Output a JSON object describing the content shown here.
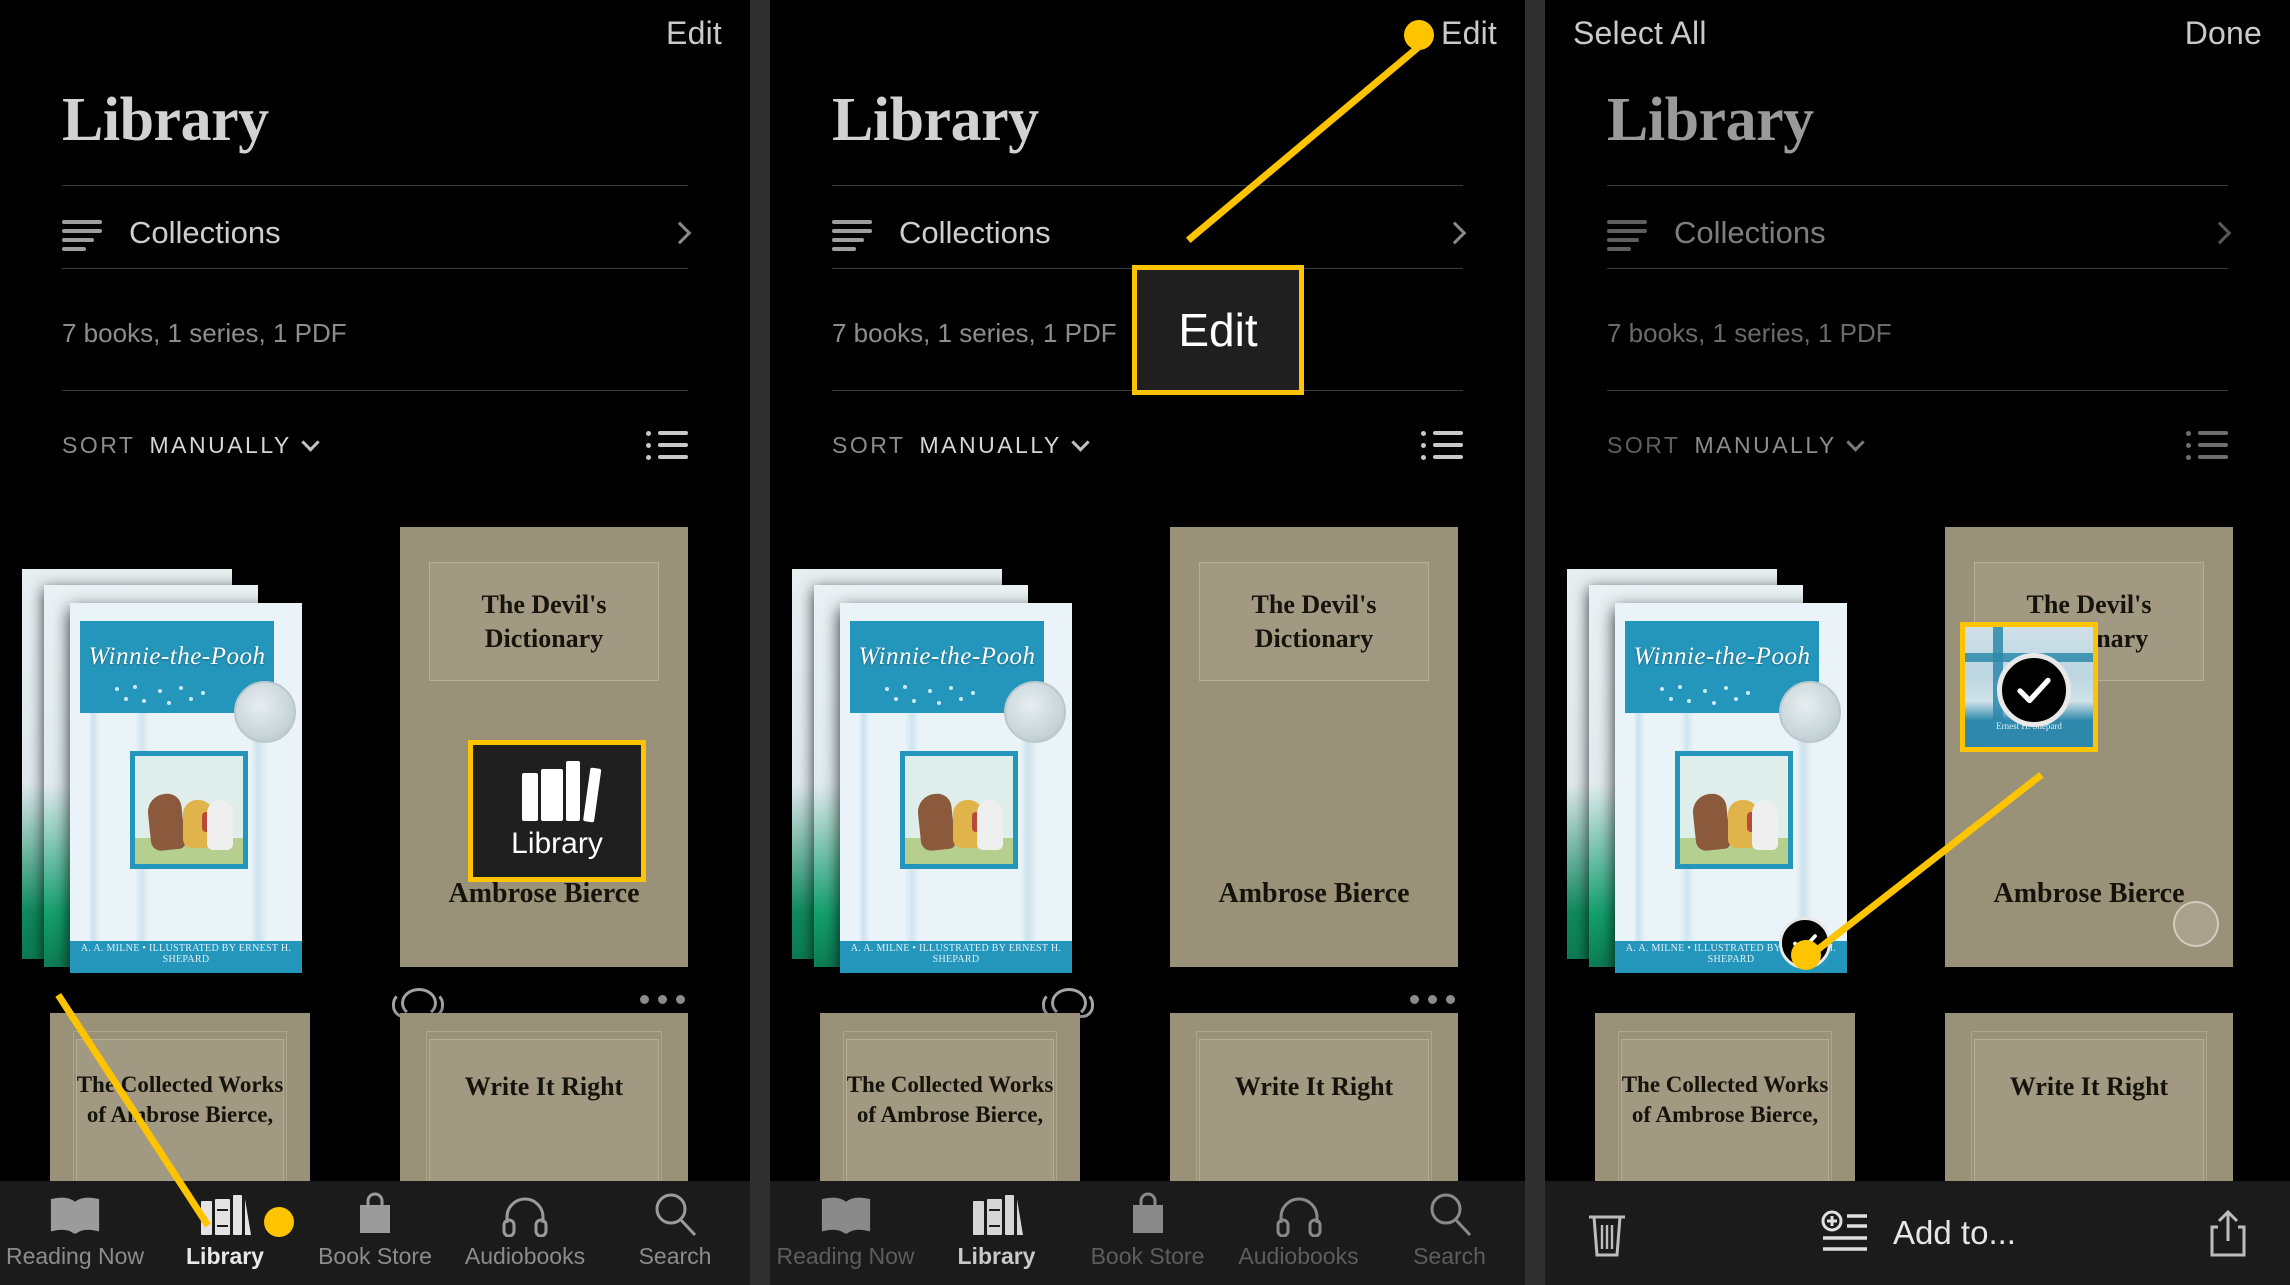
{
  "app": {
    "name": "Apple Books",
    "accent_color": "#FFC400",
    "background_color": "#000000"
  },
  "panels": [
    {
      "id": "panel-1",
      "navbar": {
        "left_label": "",
        "right_label": "Edit"
      },
      "header": {
        "title": "Library",
        "collections_label": "Collections",
        "counts": "7 books, 1 series, 1 PDF",
        "sort_word": "SORT",
        "sort_value": "MANUALLY"
      },
      "annotation": {
        "type": "callout-box",
        "icon": "library-books-icon",
        "label": "Library",
        "points_to": "library-tab"
      }
    },
    {
      "id": "panel-2",
      "navbar": {
        "left_label": "",
        "right_label": "Edit"
      },
      "header": {
        "title": "Library",
        "collections_label": "Collections",
        "counts": "7 books, 1 series, 1 PDF",
        "sort_word": "SORT",
        "sort_value": "MANUALLY"
      },
      "annotation": {
        "type": "callout-box",
        "label": "Edit",
        "points_to": "edit-button"
      }
    },
    {
      "id": "panel-3",
      "navbar": {
        "left_label": "Select All",
        "right_label": "Done"
      },
      "header": {
        "title": "Library",
        "collections_label": "Collections",
        "counts": "7 books, 1 series, 1 PDF",
        "sort_word": "SORT",
        "sort_value": "MANUALLY"
      },
      "toolbar": {
        "delete_icon": "trash-icon",
        "add_to_label": "Add to...",
        "add_to_icon": "add-to-list-icon",
        "share_icon": "share-icon"
      },
      "annotation": {
        "type": "callout-box-zoom",
        "label": "",
        "points_to": "selected-book-checkmark"
      }
    }
  ],
  "books": {
    "pooh": {
      "title": "Winnie-the-Pooh",
      "credit": "A. A. MILNE  •  ILLUSTRATED BY ERNEST H. SHEPARD",
      "credit_short": "Ernest H. Shepard"
    },
    "devils_dictionary": {
      "title_line1": "The Devil's",
      "title_line2": "Dictionary",
      "author": "Ambrose Bierce"
    },
    "collected_works": {
      "title_line1": "The Collected Works",
      "title_line2": "of Ambrose Bierce,"
    },
    "write_it_right": {
      "title": "Write It Right"
    }
  },
  "tabbar": {
    "items": [
      {
        "label": "Reading Now",
        "icon": "open-book-icon",
        "active": false
      },
      {
        "label": "Library",
        "icon": "library-books-icon",
        "active": true
      },
      {
        "label": "Book Store",
        "icon": "shopping-bag-icon",
        "active": false
      },
      {
        "label": "Audiobooks",
        "icon": "headphones-icon",
        "active": false
      },
      {
        "label": "Search",
        "icon": "search-icon",
        "active": false
      }
    ]
  },
  "icons": {
    "chevron_right": "chevron-right-icon",
    "chevron_down": "chevron-down-icon",
    "list_view": "list-view-icon",
    "collections": "collections-lines-icon",
    "cloud_download": "cloud-download-icon",
    "more_options": "ellipsis-icon",
    "checkmark": "checkmark-icon",
    "unselected_circle": "unselected-circle-icon"
  }
}
